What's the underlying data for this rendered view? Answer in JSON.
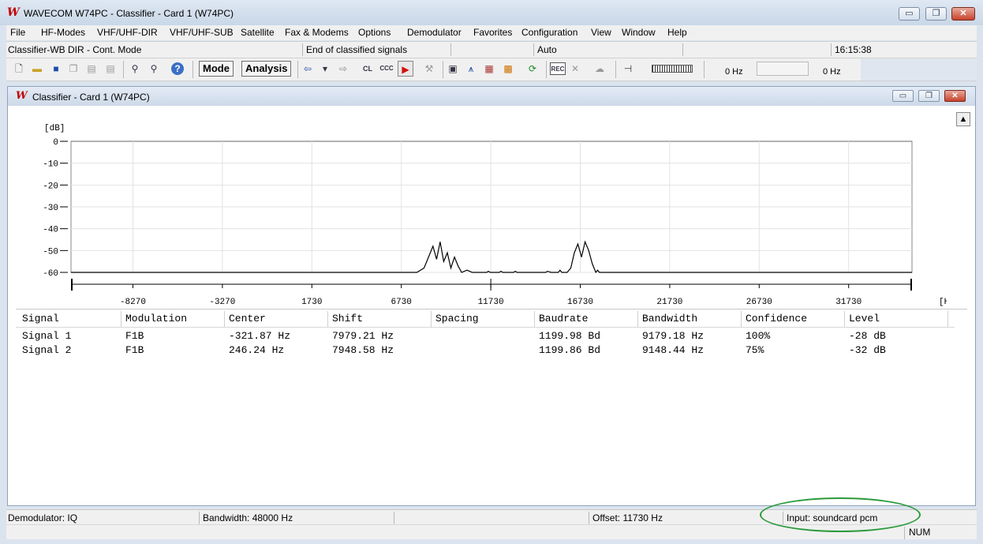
{
  "window": {
    "title": "WAVECOM W74PC - Classifier - Card 1 (W74PC)",
    "logo": "W",
    "buttons": {
      "minimize": "▭",
      "maximize": "❐",
      "close": "✕"
    }
  },
  "menubar": [
    "File",
    "HF-Modes",
    "VHF/UHF-DIR",
    "VHF/UHF-SUB",
    "Satellite",
    "Fax & Modems",
    "Options",
    "Demodulator",
    "Favorites",
    "Configuration",
    "View",
    "Window",
    "Help"
  ],
  "infobar": {
    "mode": "Classifier-WB DIR - Cont. Mode",
    "message": "End of classified signals",
    "setting": "Auto",
    "time": "16:15:38"
  },
  "toolbar": {
    "mode_label": "Mode",
    "analysis_label": "Analysis",
    "freq_left": "0 Hz",
    "freq_right": "0 Hz",
    "icons": [
      "new-file-icon",
      "open-folder-icon",
      "save-icon",
      "copy-icon",
      "print-icon",
      "print-preview-icon",
      "find-icon",
      "find-next-icon",
      "help-icon",
      "arrow-left-icon",
      "dropdown-icon",
      "arrow-right-icon",
      "cl-icon",
      "ccc-icon",
      "play-icon",
      "tools-icon",
      "display-icon",
      "antenna-icon",
      "grid-icon",
      "pattern-icon",
      "refresh-icon",
      "rec-icon",
      "mute-icon",
      "cloud-icon",
      "tuning-icon",
      "level-meter-icon"
    ],
    "icon_glyphs": {
      "cl": "CL",
      "ccc": "CCC",
      "rec": "REC"
    }
  },
  "child_window": {
    "title": "Classifier  - Card 1 (W74PC)",
    "logo": "W"
  },
  "chart_data": {
    "type": "line",
    "ylabel": "[dB]",
    "xlabel": "[Hz]",
    "ylim": [
      -60,
      0
    ],
    "yticks": [
      "0",
      "-10",
      "-20",
      "-30",
      "-40",
      "-50",
      "-60"
    ],
    "xlim": [
      -11730,
      35270
    ],
    "xticks": [
      "-8270",
      "-3270",
      "1730",
      "6730",
      "11730",
      "16730",
      "21730",
      "26730",
      "31730"
    ],
    "grid": true,
    "series": [
      {
        "points": [
          [
            -11730,
            -60
          ],
          [
            7600,
            -60
          ],
          [
            8000,
            -58
          ],
          [
            8300,
            -52
          ],
          [
            8500,
            -48
          ],
          [
            8700,
            -54
          ],
          [
            8900,
            -46
          ],
          [
            9100,
            -55
          ],
          [
            9300,
            -51
          ],
          [
            9500,
            -58
          ],
          [
            9700,
            -53
          ],
          [
            9900,
            -57
          ],
          [
            10100,
            -60
          ],
          [
            10400,
            -59
          ],
          [
            10700,
            -60
          ],
          [
            11500,
            -60
          ],
          [
            11600,
            -59.5
          ],
          [
            11700,
            -60
          ],
          [
            12200,
            -60
          ],
          [
            12300,
            -59.5
          ],
          [
            12400,
            -60
          ],
          [
            13000,
            -60
          ],
          [
            13100,
            -59.5
          ],
          [
            13200,
            -60
          ],
          [
            14800,
            -60
          ],
          [
            14900,
            -59.5
          ],
          [
            15100,
            -60
          ],
          [
            15500,
            -60
          ],
          [
            15600,
            -59
          ],
          [
            15700,
            -60
          ],
          [
            16000,
            -60
          ],
          [
            16200,
            -58
          ],
          [
            16400,
            -51
          ],
          [
            16600,
            -47
          ],
          [
            16800,
            -53
          ],
          [
            17000,
            -46
          ],
          [
            17200,
            -50
          ],
          [
            17400,
            -56
          ],
          [
            17600,
            -60
          ],
          [
            17700,
            -59
          ],
          [
            17800,
            -60
          ],
          [
            35270,
            -60
          ]
        ]
      }
    ]
  },
  "table": {
    "columns": [
      "Signal",
      "Modulation",
      "Center",
      "Shift",
      "Spacing",
      "Baudrate",
      "Bandwidth",
      "Confidence",
      "Level"
    ],
    "rows": [
      [
        "Signal 1",
        "F1B",
        "-321.87 Hz",
        "7979.21 Hz",
        "",
        "1199.98 Bd",
        "9179.18 Hz",
        "100%",
        "-28 dB"
      ],
      [
        "Signal 2",
        "F1B",
        "246.24 Hz",
        "7948.58 Hz",
        "",
        "1199.86 Bd",
        "9148.44 Hz",
        "75%",
        "-32 dB"
      ]
    ]
  },
  "statusbar": {
    "demodulator": "Demodulator: IQ",
    "bandwidth": "Bandwidth: 48000 Hz",
    "offset": "Offset: 11730 Hz",
    "input": "Input: soundcard pcm",
    "num": "NUM"
  },
  "colors": {
    "highlight_ellipse": "#2b9a3b",
    "logo": "#c00000"
  }
}
